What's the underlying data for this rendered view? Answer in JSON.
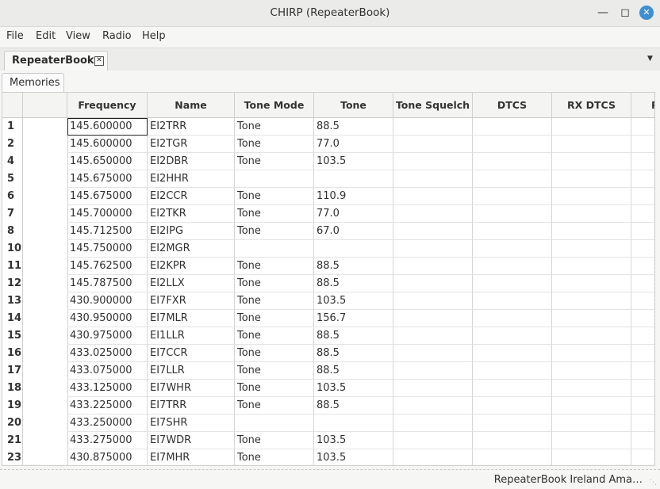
{
  "window": {
    "title": "CHIRP (RepeaterBook)",
    "buttons": [
      "minimize-icon",
      "maximize-icon",
      "close-icon"
    ]
  },
  "menu": [
    "File",
    "Edit",
    "View",
    "Radio",
    "Help"
  ],
  "tabs": {
    "document_tab": "RepeaterBook",
    "sub_tab": "Memories"
  },
  "columns": [
    "Frequency",
    "Name",
    "Tone Mode",
    "Tone",
    "Tone Squelch",
    "DTCS",
    "RX DTCS",
    "P"
  ],
  "rows": [
    {
      "num": "1",
      "freq": "145.600000",
      "name": "EI2TRR",
      "mode": "Tone",
      "tone": "88.5"
    },
    {
      "num": "2",
      "freq": "145.600000",
      "name": "EI2TGR",
      "mode": "Tone",
      "tone": "77.0"
    },
    {
      "num": "4",
      "freq": "145.650000",
      "name": "EI2DBR",
      "mode": "Tone",
      "tone": "103.5"
    },
    {
      "num": "5",
      "freq": "145.675000",
      "name": "EI2HHR",
      "mode": "",
      "tone": ""
    },
    {
      "num": "6",
      "freq": "145.675000",
      "name": "EI2CCR",
      "mode": "Tone",
      "tone": "110.9"
    },
    {
      "num": "7",
      "freq": "145.700000",
      "name": "EI2TKR",
      "mode": "Tone",
      "tone": "77.0"
    },
    {
      "num": "8",
      "freq": "145.712500",
      "name": "EI2IPG",
      "mode": "Tone",
      "tone": "67.0"
    },
    {
      "num": "10",
      "freq": "145.750000",
      "name": "EI2MGR",
      "mode": "",
      "tone": ""
    },
    {
      "num": "11",
      "freq": "145.762500",
      "name": "EI2KPR",
      "mode": "Tone",
      "tone": "88.5"
    },
    {
      "num": "12",
      "freq": "145.787500",
      "name": "EI2LLX",
      "mode": "Tone",
      "tone": "88.5"
    },
    {
      "num": "13",
      "freq": "430.900000",
      "name": "EI7FXR",
      "mode": "Tone",
      "tone": "103.5"
    },
    {
      "num": "14",
      "freq": "430.950000",
      "name": "EI7MLR",
      "mode": "Tone",
      "tone": "156.7"
    },
    {
      "num": "15",
      "freq": "430.975000",
      "name": "EI1LLR",
      "mode": "Tone",
      "tone": "88.5"
    },
    {
      "num": "16",
      "freq": "433.025000",
      "name": "EI7CCR",
      "mode": "Tone",
      "tone": "88.5"
    },
    {
      "num": "17",
      "freq": "433.075000",
      "name": "EI7LLR",
      "mode": "Tone",
      "tone": "88.5"
    },
    {
      "num": "18",
      "freq": "433.125000",
      "name": "EI7WHR",
      "mode": "Tone",
      "tone": "103.5"
    },
    {
      "num": "19",
      "freq": "433.225000",
      "name": "EI7TRR",
      "mode": "Tone",
      "tone": "88.5"
    },
    {
      "num": "20",
      "freq": "433.250000",
      "name": "EI7SHR",
      "mode": "",
      "tone": ""
    },
    {
      "num": "21",
      "freq": "433.275000",
      "name": "EI7WDR",
      "mode": "Tone",
      "tone": "103.5"
    },
    {
      "num": "23",
      "freq": "430.875000",
      "name": "EI7MHR",
      "mode": "Tone",
      "tone": "103.5"
    }
  ],
  "status": "RepeaterBook Ireland Ama…",
  "icons": {
    "tab_close": "close-icon",
    "tab_menu": "chevron-down-icon",
    "resize": "resize-grip-icon"
  }
}
